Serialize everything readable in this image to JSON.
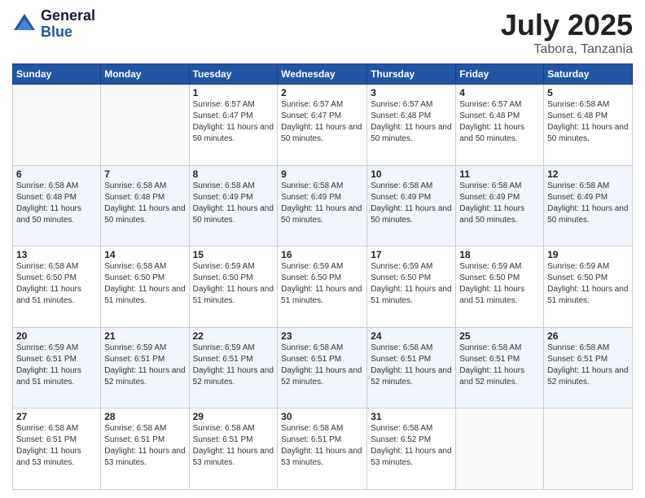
{
  "header": {
    "logo_general": "General",
    "logo_blue": "Blue",
    "month": "July 2025",
    "location": "Tabora, Tanzania"
  },
  "weekdays": [
    "Sunday",
    "Monday",
    "Tuesday",
    "Wednesday",
    "Thursday",
    "Friday",
    "Saturday"
  ],
  "weeks": [
    [
      {
        "day": "",
        "info": ""
      },
      {
        "day": "",
        "info": ""
      },
      {
        "day": "1",
        "info": "Sunrise: 6:57 AM\nSunset: 6:47 PM\nDaylight: 11 hours and 50 minutes."
      },
      {
        "day": "2",
        "info": "Sunrise: 6:57 AM\nSunset: 6:47 PM\nDaylight: 11 hours and 50 minutes."
      },
      {
        "day": "3",
        "info": "Sunrise: 6:57 AM\nSunset: 6:48 PM\nDaylight: 11 hours and 50 minutes."
      },
      {
        "day": "4",
        "info": "Sunrise: 6:57 AM\nSunset: 6:48 PM\nDaylight: 11 hours and 50 minutes."
      },
      {
        "day": "5",
        "info": "Sunrise: 6:58 AM\nSunset: 6:48 PM\nDaylight: 11 hours and 50 minutes."
      }
    ],
    [
      {
        "day": "6",
        "info": "Sunrise: 6:58 AM\nSunset: 6:48 PM\nDaylight: 11 hours and 50 minutes."
      },
      {
        "day": "7",
        "info": "Sunrise: 6:58 AM\nSunset: 6:48 PM\nDaylight: 11 hours and 50 minutes."
      },
      {
        "day": "8",
        "info": "Sunrise: 6:58 AM\nSunset: 6:49 PM\nDaylight: 11 hours and 50 minutes."
      },
      {
        "day": "9",
        "info": "Sunrise: 6:58 AM\nSunset: 6:49 PM\nDaylight: 11 hours and 50 minutes."
      },
      {
        "day": "10",
        "info": "Sunrise: 6:58 AM\nSunset: 6:49 PM\nDaylight: 11 hours and 50 minutes."
      },
      {
        "day": "11",
        "info": "Sunrise: 6:58 AM\nSunset: 6:49 PM\nDaylight: 11 hours and 50 minutes."
      },
      {
        "day": "12",
        "info": "Sunrise: 6:58 AM\nSunset: 6:49 PM\nDaylight: 11 hours and 50 minutes."
      }
    ],
    [
      {
        "day": "13",
        "info": "Sunrise: 6:58 AM\nSunset: 6:50 PM\nDaylight: 11 hours and 51 minutes."
      },
      {
        "day": "14",
        "info": "Sunrise: 6:58 AM\nSunset: 6:50 PM\nDaylight: 11 hours and 51 minutes."
      },
      {
        "day": "15",
        "info": "Sunrise: 6:59 AM\nSunset: 6:50 PM\nDaylight: 11 hours and 51 minutes."
      },
      {
        "day": "16",
        "info": "Sunrise: 6:59 AM\nSunset: 6:50 PM\nDaylight: 11 hours and 51 minutes."
      },
      {
        "day": "17",
        "info": "Sunrise: 6:59 AM\nSunset: 6:50 PM\nDaylight: 11 hours and 51 minutes."
      },
      {
        "day": "18",
        "info": "Sunrise: 6:59 AM\nSunset: 6:50 PM\nDaylight: 11 hours and 51 minutes."
      },
      {
        "day": "19",
        "info": "Sunrise: 6:59 AM\nSunset: 6:50 PM\nDaylight: 11 hours and 51 minutes."
      }
    ],
    [
      {
        "day": "20",
        "info": "Sunrise: 6:59 AM\nSunset: 6:51 PM\nDaylight: 11 hours and 51 minutes."
      },
      {
        "day": "21",
        "info": "Sunrise: 6:59 AM\nSunset: 6:51 PM\nDaylight: 11 hours and 52 minutes."
      },
      {
        "day": "22",
        "info": "Sunrise: 6:59 AM\nSunset: 6:51 PM\nDaylight: 11 hours and 52 minutes."
      },
      {
        "day": "23",
        "info": "Sunrise: 6:58 AM\nSunset: 6:51 PM\nDaylight: 11 hours and 52 minutes."
      },
      {
        "day": "24",
        "info": "Sunrise: 6:58 AM\nSunset: 6:51 PM\nDaylight: 11 hours and 52 minutes."
      },
      {
        "day": "25",
        "info": "Sunrise: 6:58 AM\nSunset: 6:51 PM\nDaylight: 11 hours and 52 minutes."
      },
      {
        "day": "26",
        "info": "Sunrise: 6:58 AM\nSunset: 6:51 PM\nDaylight: 11 hours and 52 minutes."
      }
    ],
    [
      {
        "day": "27",
        "info": "Sunrise: 6:58 AM\nSunset: 6:51 PM\nDaylight: 11 hours and 53 minutes."
      },
      {
        "day": "28",
        "info": "Sunrise: 6:58 AM\nSunset: 6:51 PM\nDaylight: 11 hours and 53 minutes."
      },
      {
        "day": "29",
        "info": "Sunrise: 6:58 AM\nSunset: 6:51 PM\nDaylight: 11 hours and 53 minutes."
      },
      {
        "day": "30",
        "info": "Sunrise: 6:58 AM\nSunset: 6:51 PM\nDaylight: 11 hours and 53 minutes."
      },
      {
        "day": "31",
        "info": "Sunrise: 6:58 AM\nSunset: 6:52 PM\nDaylight: 11 hours and 53 minutes."
      },
      {
        "day": "",
        "info": ""
      },
      {
        "day": "",
        "info": ""
      }
    ]
  ]
}
